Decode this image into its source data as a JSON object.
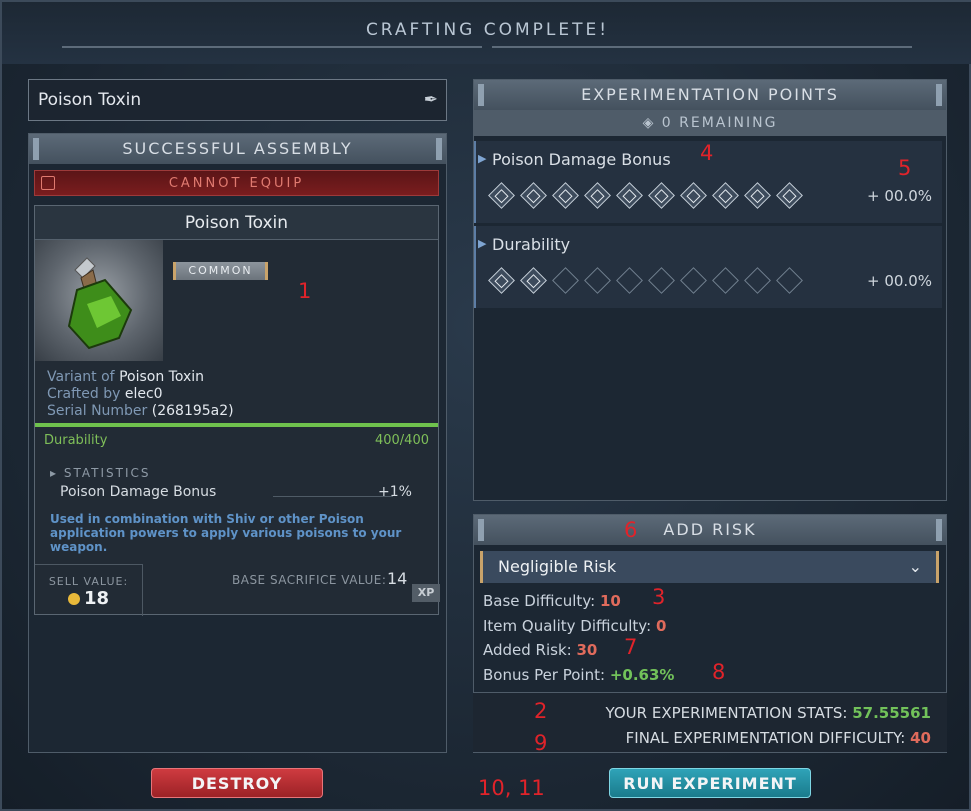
{
  "window": {
    "title": "CRAFTING COMPLETE!"
  },
  "name_field": {
    "value": "Poison Toxin"
  },
  "assembly": {
    "header": "SUCCESSFUL ASSEMBLY",
    "cannot_equip": "CANNOT EQUIP",
    "item_title": "Poison Toxin",
    "rarity": "COMMON",
    "variant_label": "Variant of",
    "variant_value": "Poison Toxin",
    "crafted_label": "Crafted by",
    "crafted_value": "elec0",
    "serial_label": "Serial Number",
    "serial_value": "(268195a2)",
    "durability_label": "Durability",
    "durability_value": "400/400",
    "durability_fraction": 1.0,
    "statistics_header": "STATISTICS",
    "stat_name": "Poison Damage Bonus",
    "stat_value": "+1%",
    "description": "Used in combination with Shiv or other Poison application powers to apply various poisons to your weapon.",
    "sell_label": "SELL VALUE:",
    "sell_value": "18",
    "sacrifice_label": "BASE SACRIFICE VALUE:",
    "sacrifice_value": "14",
    "xp_label": "XP"
  },
  "experimentation": {
    "header": "EXPERIMENTATION POINTS",
    "remaining": "0 REMAINING",
    "properties": [
      {
        "name": "Poison Damage Bonus",
        "value": "+ 00.0%",
        "filled": 10,
        "total": 10
      },
      {
        "name": "Durability",
        "value": "+ 00.0%",
        "filled": 2,
        "total": 10
      }
    ]
  },
  "risk": {
    "header": "ADD RISK",
    "selected": "Negligible Risk",
    "base_difficulty_label": "Base Difficulty:",
    "base_difficulty_value": "10",
    "item_quality_label": "Item Quality Difficulty:",
    "item_quality_value": "0",
    "added_risk_label": "Added Risk:",
    "added_risk_value": "30",
    "bonus_label": "Bonus Per Point:",
    "bonus_value": "+0.63%",
    "stats_label": "YOUR EXPERIMENTATION STATS:",
    "stats_value": "57.55561",
    "final_label": "FINAL EXPERIMENTATION DIFFICULTY:",
    "final_value": "40"
  },
  "buttons": {
    "destroy": "DESTROY",
    "run": "RUN EXPERIMENT"
  },
  "annotations": [
    "1",
    "2",
    "3",
    "4",
    "5",
    "6",
    "7",
    "8",
    "9",
    "10, 11"
  ],
  "colors": {
    "accent_red": "#e06b5c",
    "accent_green": "#72c25a",
    "destroy": "#b52c31",
    "run": "#23909f"
  }
}
